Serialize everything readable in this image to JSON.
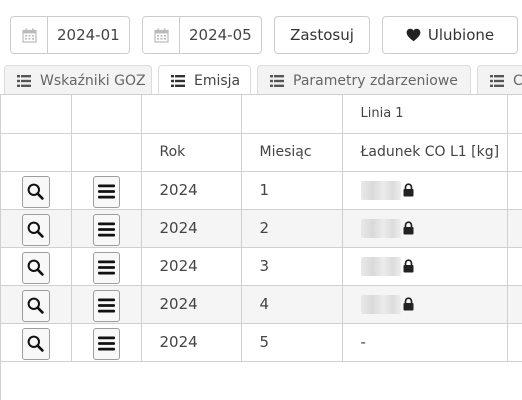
{
  "filters": {
    "date_from": {
      "value": "2024-01",
      "icon": "calendar-icon"
    },
    "date_to": {
      "value": "2024-05",
      "icon": "calendar-icon"
    },
    "apply_label": "Zastosuj",
    "favorites_label": "Ulubione",
    "favorites_icon": "heart-icon"
  },
  "tabs": [
    {
      "label": "Wskaźniki GOZ",
      "icon": "list-icon",
      "active": false
    },
    {
      "label": "Emisja",
      "icon": "list-icon",
      "active": true
    },
    {
      "label": "Parametry zdarzeniowe",
      "icon": "list-icon",
      "active": false
    },
    {
      "label": "C",
      "icon": "list-icon",
      "active": false
    }
  ],
  "table": {
    "group_header": "Linia 1",
    "columns": [
      "",
      "",
      "Rok",
      "Miesiąc",
      "Ładunek CO L1 [kg]"
    ],
    "rows": [
      {
        "rok": "2024",
        "miesiac": "1",
        "ladunek": "",
        "masked": true,
        "locked": true
      },
      {
        "rok": "2024",
        "miesiac": "2",
        "ladunek": "",
        "masked": true,
        "locked": true
      },
      {
        "rok": "2024",
        "miesiac": "3",
        "ladunek": "",
        "masked": true,
        "locked": true
      },
      {
        "rok": "2024",
        "miesiac": "4",
        "ladunek": "",
        "masked": true,
        "locked": true
      },
      {
        "rok": "2024",
        "miesiac": "5",
        "ladunek": "-",
        "masked": false,
        "locked": false
      }
    ],
    "row_icons": [
      "search-icon",
      "menu-icon",
      "lock-icon"
    ]
  }
}
